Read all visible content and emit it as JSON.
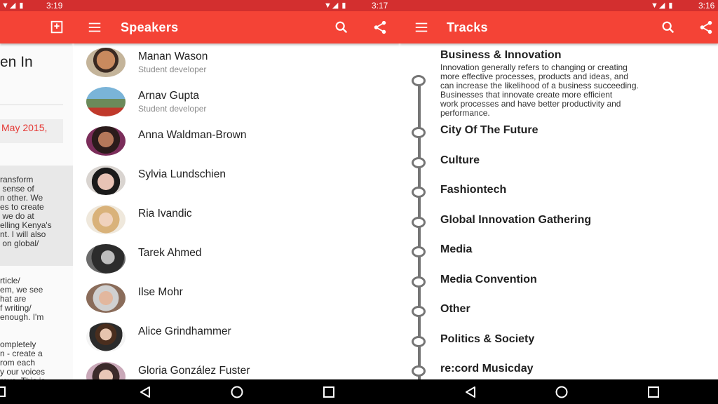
{
  "panel1": {
    "status": {
      "time": "3:19"
    },
    "title_fragment": "en In",
    "date_fragment": "May 2015,",
    "quote_lines": [
      "ransform",
      " sense of",
      "n other. We",
      "es to create",
      " we do at",
      "elling Kenya's",
      "nt. I will also",
      " on global/"
    ],
    "body_lines": [
      "rticle/",
      "em, we see",
      "hat are",
      "f writing/",
      "enough. I'm",
      "",
      "ompletely",
      "n - create a",
      "rom each",
      "y our voices",
      "rove. This is"
    ]
  },
  "panel2": {
    "status": {
      "time": "3:17"
    },
    "toolbar_title": "Speakers",
    "speakers": [
      {
        "name": "Manan Wason",
        "subtitle": "Student developer"
      },
      {
        "name": "Arnav Gupta",
        "subtitle": "Student developer"
      },
      {
        "name": "Anna Waldman-Brown",
        "subtitle": ""
      },
      {
        "name": "Sylvia Lundschien",
        "subtitle": ""
      },
      {
        "name": "Ria Ivandic",
        "subtitle": ""
      },
      {
        "name": "Tarek Ahmed",
        "subtitle": ""
      },
      {
        "name": "Ilse Mohr",
        "subtitle": ""
      },
      {
        "name": "Alice Grindhammer",
        "subtitle": ""
      },
      {
        "name": "Gloria González Fuster",
        "subtitle": ""
      }
    ]
  },
  "panel3": {
    "status": {
      "time": "3:16"
    },
    "toolbar_title": "Tracks",
    "tracks": [
      {
        "title": "Business & Innovation"
      },
      {
        "title": "City Of The Future"
      },
      {
        "title": "Culture"
      },
      {
        "title": "Fashiontech"
      },
      {
        "title": "Global Innovation Gathering"
      },
      {
        "title": "Media"
      },
      {
        "title": "Media Convention"
      },
      {
        "title": "Other"
      },
      {
        "title": "Politics & Society"
      },
      {
        "title": "re:cord Musicday"
      }
    ],
    "first_track_description": "Innovation generally refers to changing or creating\nmore effective processes, products and ideas, and\ncan increase the likelihood of a business succeeding.\nBusinesses that innovate create more efficient\nwork processes and have better productivity and\nperformance."
  },
  "colors": {
    "toolbar": "#f44336",
    "statusbar": "#d32f2f",
    "accent_text": "#e53935"
  },
  "icons": [
    "menu-icon",
    "search-icon",
    "share-icon",
    "bookmark-icon",
    "wifi-icon",
    "signal-icon",
    "battery-icon",
    "back-icon",
    "home-icon",
    "recents-icon"
  ]
}
